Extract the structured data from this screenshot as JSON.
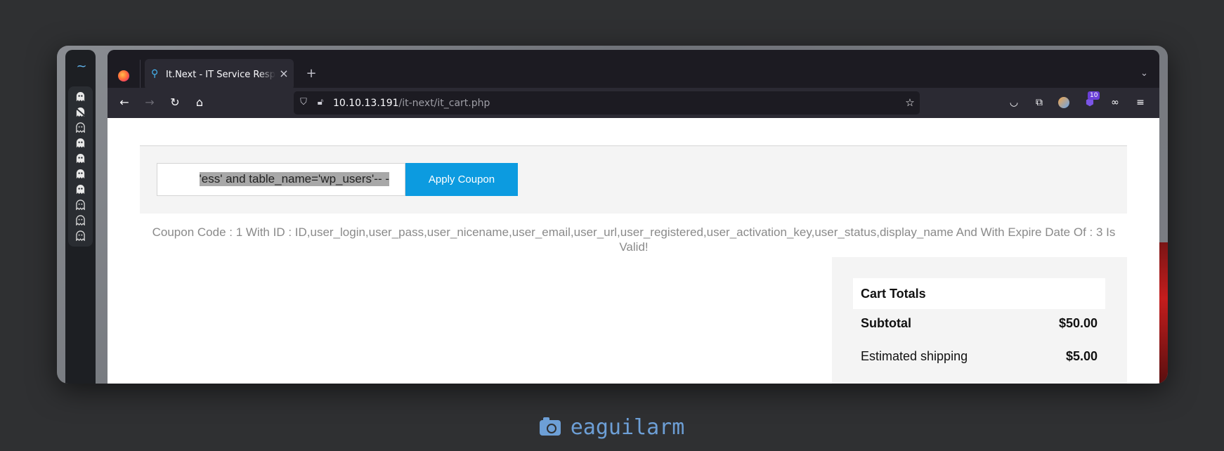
{
  "browser": {
    "tab": {
      "title": "It.Next - IT Service Responsive",
      "close": "×"
    },
    "new_tab": "+",
    "url": {
      "host": "10.10.13.191",
      "path": "/it-next/it_cart.php"
    },
    "extension_badge": "10"
  },
  "page": {
    "coupon": {
      "input_value": "'ess' and table_name='wp_users'-- -",
      "apply_label": "Apply Coupon",
      "message": "Coupon Code : 1 With ID : ID,user_login,user_pass,user_nicename,user_email,user_url,user_registered,user_activation_key,user_status,display_name And With Expire Date Of : 3 Is Valid!"
    },
    "cart": {
      "heading": "Cart Totals",
      "rows": [
        {
          "label": "Subtotal",
          "value": "$50.00"
        },
        {
          "label": "Estimated shipping",
          "value": "$5.00"
        }
      ]
    }
  },
  "caption": {
    "user": "eaguilarm",
    "icon": "camera-icon"
  },
  "colors": {
    "accent": "#0c9be0",
    "caption": "#6d9fd6",
    "browser_bg": "#1c1b22"
  }
}
